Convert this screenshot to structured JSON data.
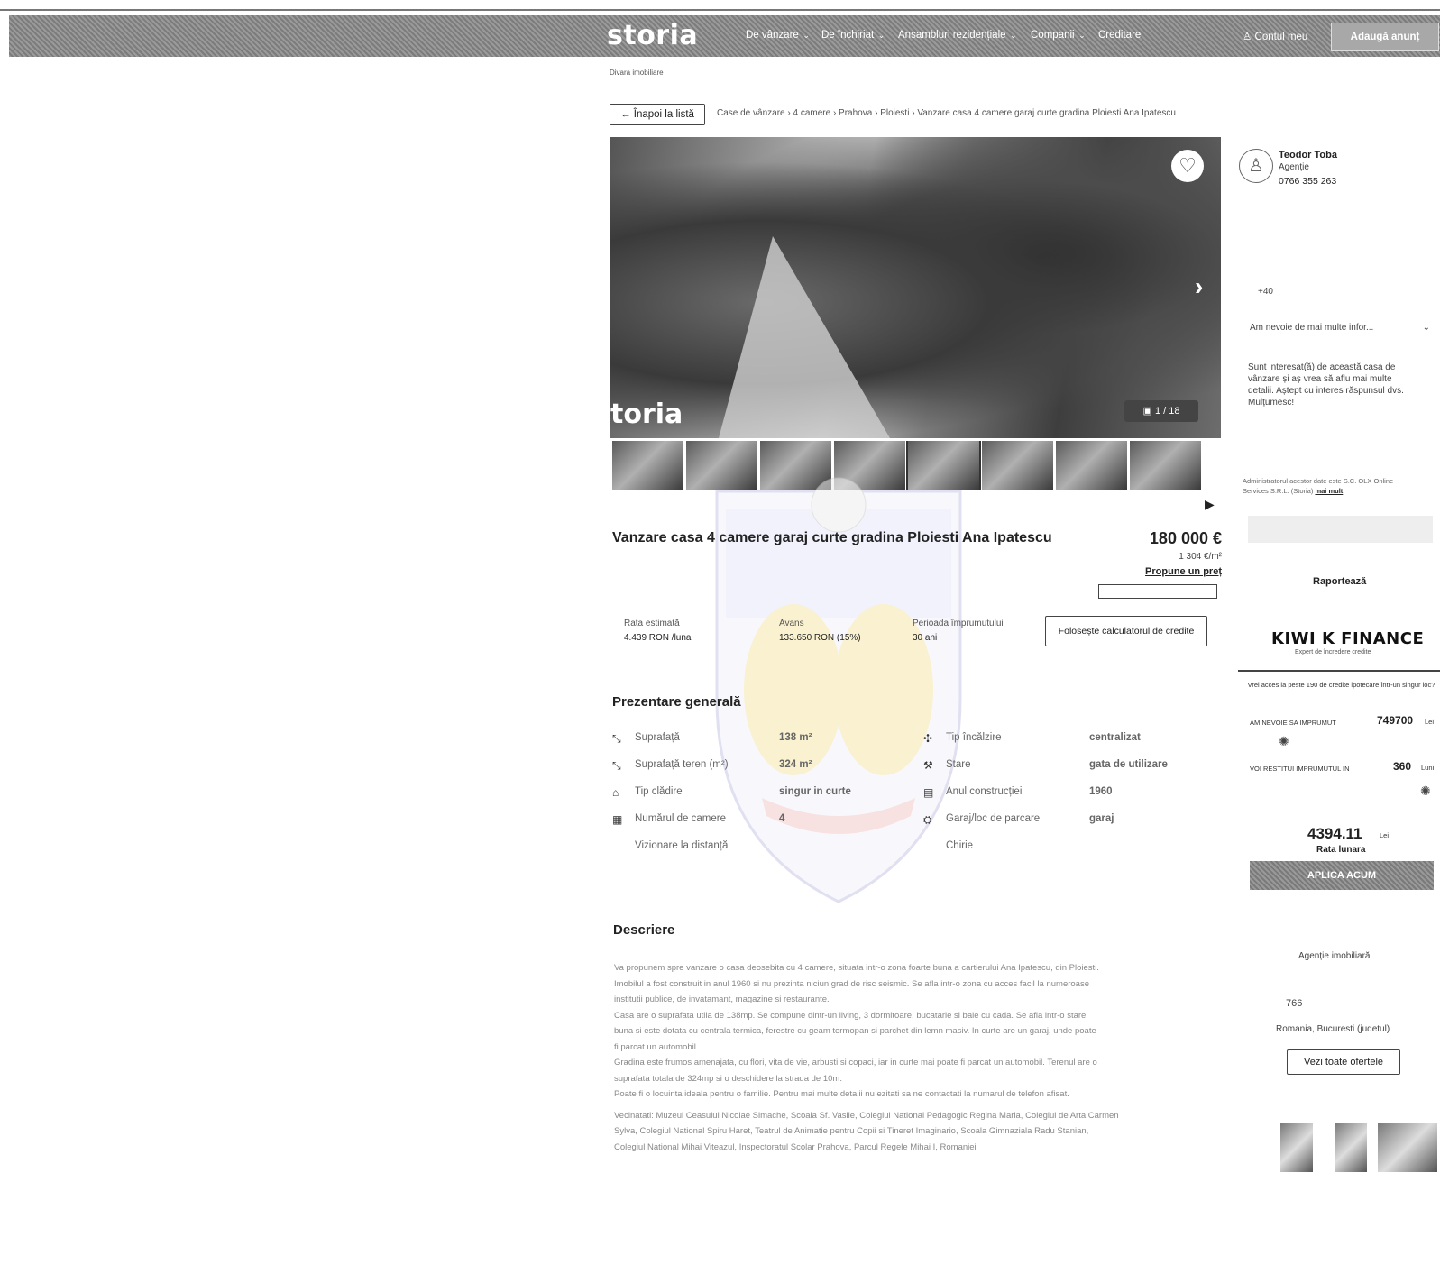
{
  "nav": {
    "logo": "storia",
    "items": [
      "De vânzare",
      "De închiriat",
      "Ansambluri rezidențiale",
      "Companii",
      "Creditare"
    ],
    "account": "Contul meu",
    "add_listing": "Adaugă anunț"
  },
  "subheader": "Divara imobiliare",
  "breadcrumb": {
    "back": "Înapoi la listă",
    "path": "Case de vânzare  ›  4 camere  ›  Prahova  ›  Ploiesti  ›  Vanzare casa 4 camere garaj curte gradina Ploiesti Ana Ipatescu"
  },
  "gallery": {
    "counter": "1 / 18",
    "watermark": "toria"
  },
  "listing": {
    "title": "Vanzare casa 4 camere garaj curte gradina Ploiesti Ana Ipatescu",
    "price": "180 000 €",
    "price_per_m2": "1 304 €/m²",
    "propose": "Propune un preț"
  },
  "credit": {
    "rate_label": "Rata estimată",
    "rate_value": "4.439 RON /luna",
    "advance_label": "Avans",
    "advance_value": "133.650 RON (15%)",
    "period_label": "Perioada împrumutului",
    "period_value": "30 ani",
    "calc_button": "Folosește calculatorul de credite"
  },
  "overview": {
    "heading": "Prezentare generală",
    "left": [
      {
        "icon": "area-icon",
        "glyph": "⤡",
        "label": "Suprafață",
        "value": "138 m²"
      },
      {
        "icon": "land-area-icon",
        "glyph": "⤡",
        "label": "Suprafață teren (m²)",
        "value": "324 m²"
      },
      {
        "icon": "building-type-icon",
        "glyph": "⌂",
        "label": "Tip clădire",
        "value": "singur in curte"
      },
      {
        "icon": "rooms-icon",
        "glyph": "▦",
        "label": "Numărul de camere",
        "value": "4"
      },
      {
        "icon": "",
        "glyph": "",
        "label": "Vizionare la distanță",
        "value": ""
      }
    ],
    "right": [
      {
        "icon": "heating-icon",
        "glyph": "✣",
        "label": "Tip încălzire",
        "value": "centralizat"
      },
      {
        "icon": "condition-icon",
        "glyph": "⚒",
        "label": "Stare",
        "value": "gata de utilizare"
      },
      {
        "icon": "calendar-icon",
        "glyph": "▤",
        "label": "Anul construcției",
        "value": "1960"
      },
      {
        "icon": "parking-icon",
        "glyph": "⛭",
        "label": "Garaj/loc de parcare",
        "value": "garaj"
      },
      {
        "icon": "",
        "glyph": "",
        "label": "Chirie",
        "value": ""
      }
    ]
  },
  "description": {
    "heading": "Descriere",
    "paragraphs": [
      "Va propunem spre vanzare o casa deosebita cu 4 camere, situata intr-o zona foarte buna a cartierului Ana Ipatescu, din Ploiesti.",
      "Imobilul a fost construit in anul 1960 si nu prezinta niciun grad de risc seismic. Se afla intr-o zona cu acces facil la numeroase",
      "institutii publice, de invatamant, magazine si restaurante.",
      "Casa are o suprafata utila de 138mp. Se compune dintr-un living, 3 dormitoare, bucatarie si baie cu cada. Se afla intr-o stare",
      "buna si este dotata cu centrala termica, ferestre cu geam termopan si parchet din lemn masiv. In curte are un garaj, unde poate",
      "fi parcat un automobil.",
      "Gradina este frumos amenajata, cu flori, vita de vie, arbusti si copaci, iar in curte mai poate fi parcat un automobil. Terenul are o",
      "suprafata totala de 324mp si o deschidere la strada de 10m.",
      "Poate fi o locuinta ideala pentru o familie. Pentru mai multe detalii nu ezitati sa ne contactati la numarul de telefon afisat."
    ],
    "nearby": [
      "Vecinatati: Muzeul Ceasului Nicolae Simache, Scoala Sf. Vasile, Colegiul National Pedagogic Regina Maria, Colegiul de Arta Carmen",
      "Sylva, Colegiul National Spiru Haret, Teatrul de Animatie pentru Copii si Tineret Imaginario, Scoala Gimnaziala Radu Stanian,",
      "Colegiul National Mihai Viteazul, Inspectoratul Scolar Prahova, Parcul Regele Mihai I, Romaniei"
    ]
  },
  "sidebar": {
    "agent_name": "Teodor Toba",
    "agent_role": "Agenție",
    "agent_phone": "0766 355 263",
    "phone_prefix": "+40",
    "info_select": "Am nevoie de mai multe infor...",
    "message": "Sunt interesat(ă) de această casa de vânzare și aș vrea să aflu mai multe detalii. Aștept cu interes răspunsul dvs.",
    "message_end": "Mulțumesc!",
    "consent": "Administratorul acestor date este S.C. OLX Online Services S.R.L. (Storia)",
    "more": "mai mult",
    "report": "Raportează",
    "kiwi_logo": "KIWI K FINANCE",
    "kiwi_sub": "Expert de încredere credite",
    "kiwi_promo": "Vrei acces la peste 190 de credite ipotecare într-un singur loc?",
    "need_label": "AM NEVOIE SA IMPRUMUT",
    "need_value": "749700",
    "need_unit": "Lei",
    "pay_label": "VOI RESTITUI IMPRUMUTUL IN",
    "pay_value": "360",
    "pay_unit": "Luni",
    "monthly_value": "4394.11",
    "monthly_unit": "Lei",
    "monthly_label": "Rata lunara",
    "apply": "APLICA ACUM",
    "agency_type": "Agenție imobiliară",
    "agency_phone": "766",
    "agency_location": "Romania, Bucuresti (judetul)",
    "see_offers": "Vezi toate ofertele"
  }
}
